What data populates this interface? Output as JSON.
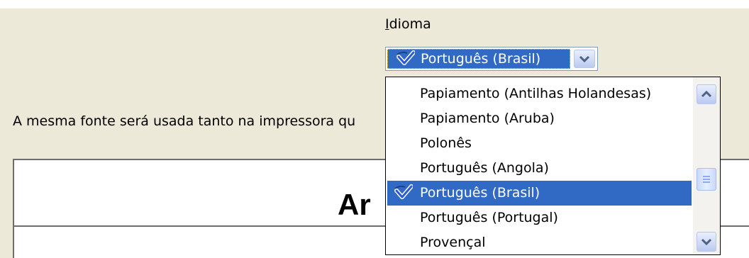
{
  "language_label": {
    "accel": "I",
    "rest": "dioma"
  },
  "language_combo": {
    "selected": "Português (Brasil)",
    "icons": {
      "spellcheck": "spellcheck-check-icon",
      "expand": "chevron-down-icon"
    }
  },
  "description": "A mesma fonte será usada tanto na impressora qu",
  "preview_text": "Ar",
  "dropdown": {
    "items": [
      {
        "label": "Papiamento (Antilhas Holandesas)",
        "checked": false
      },
      {
        "label": "Papiamento (Aruba)",
        "checked": false
      },
      {
        "label": "Polonês",
        "checked": false
      },
      {
        "label": "Português (Angola)",
        "checked": false
      },
      {
        "label": "Português (Brasil)",
        "checked": true,
        "selected": true
      },
      {
        "label": "Português (Portugal)",
        "checked": false
      },
      {
        "label": "Provençal",
        "checked": false
      }
    ],
    "scrollbar": {
      "up_icon": "chevron-up-icon",
      "down_icon": "chevron-down-icon",
      "position": 0.5
    }
  },
  "colors": {
    "selection": "#316ac5",
    "dialog_background": "#ece9d8",
    "check": "#2a5bd7"
  }
}
